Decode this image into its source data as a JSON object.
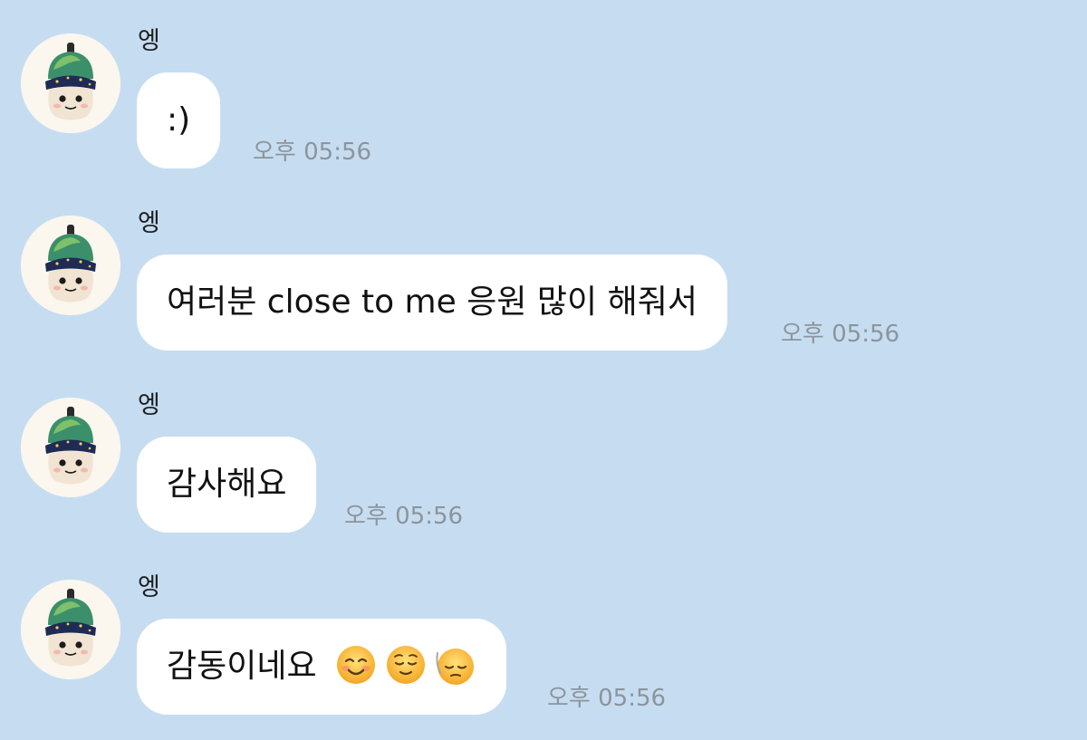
{
  "chat": {
    "background_color": "#c6ddf1",
    "bubble_color": "#ffffff",
    "timestamp_color": "#8c949c",
    "messages": [
      {
        "sender": "엥",
        "text": ":)",
        "time": "오후 05:56",
        "avatar": "plush-doll-avatar"
      },
      {
        "sender": "엥",
        "text": "여러분 close to me 응원 많이 해줘서",
        "time": "오후 05:56",
        "avatar": "plush-doll-avatar"
      },
      {
        "sender": "엥",
        "text": "감사해요",
        "time": "오후 05:56",
        "avatar": "plush-doll-avatar"
      },
      {
        "sender": "엥",
        "text": "감동이네요",
        "time": "오후 05:56",
        "avatar": "plush-doll-avatar",
        "emojis": [
          "smiling-face-emoji",
          "relieved-face-emoji",
          "pensive-face-emoji"
        ]
      }
    ]
  }
}
